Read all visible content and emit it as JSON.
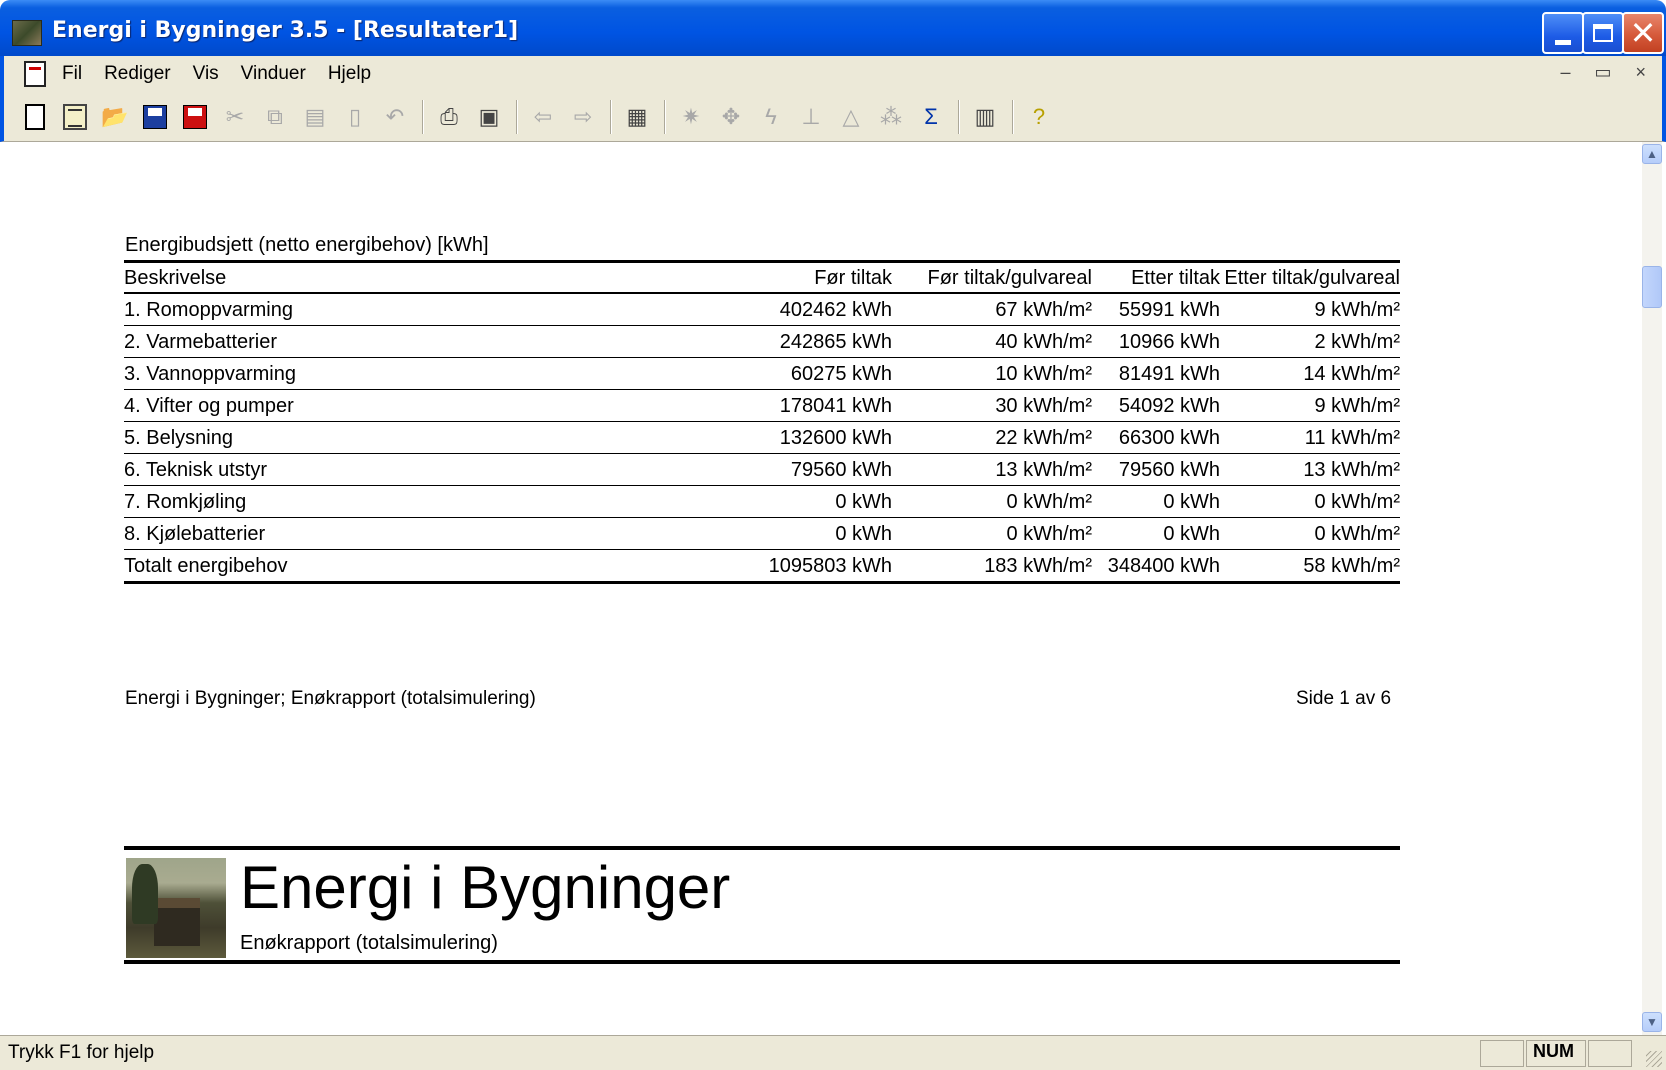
{
  "window": {
    "title": "Energi i Bygninger 3.5 - [Resultater1]"
  },
  "menu": {
    "items": [
      "Fil",
      "Rediger",
      "Vis",
      "Vinduer",
      "Hjelp"
    ]
  },
  "toolbar": {
    "icons": [
      "new-document-icon",
      "open-sheet-icon",
      "open-folder-icon",
      "save-icon",
      "save-as-icon",
      "cut-icon",
      "copy-icon",
      "paste-icon",
      "clipboard-icon",
      "undo-icon",
      "print-icon",
      "print-preview-icon",
      "back-arrow-icon",
      "forward-arrow-icon",
      "calculator-icon",
      "sun-icon",
      "crosshair-icon",
      "lightning-icon",
      "building-icon",
      "shape-icon",
      "sparkle-icon",
      "sigma-icon",
      "monitor-icon",
      "help-icon"
    ]
  },
  "report": {
    "section_title": "Energibudsjett (netto energibehov) [kWh]",
    "columns": [
      "Beskrivelse",
      "Før tiltak",
      "Før tiltak/gulvareal",
      "Etter tiltak",
      "Etter tiltak/gulvareal"
    ],
    "rows": [
      [
        "1. Romoppvarming",
        "402462 kWh",
        "67 kWh/m²",
        "55991 kWh",
        "9 kWh/m²"
      ],
      [
        "2. Varmebatterier",
        "242865 kWh",
        "40 kWh/m²",
        "10966 kWh",
        "2 kWh/m²"
      ],
      [
        "3. Vannoppvarming",
        "60275 kWh",
        "10 kWh/m²",
        "81491 kWh",
        "14 kWh/m²"
      ],
      [
        "4. Vifter og pumper",
        "178041 kWh",
        "30 kWh/m²",
        "54092 kWh",
        "9 kWh/m²"
      ],
      [
        "5. Belysning",
        "132600 kWh",
        "22 kWh/m²",
        "66300 kWh",
        "11 kWh/m²"
      ],
      [
        "6. Teknisk utstyr",
        "79560 kWh",
        "13 kWh/m²",
        "79560 kWh",
        "13 kWh/m²"
      ],
      [
        "7. Romkjøling",
        "0 kWh",
        "0 kWh/m²",
        "0 kWh",
        "0 kWh/m²"
      ],
      [
        "8. Kjølebatterier",
        "0 kWh",
        "0 kWh/m²",
        "0 kWh",
        "0 kWh/m²"
      ]
    ],
    "total": [
      "Totalt energibehov",
      "1095803 kWh",
      "183 kWh/m²",
      "348400 kWh",
      "58 kWh/m²"
    ],
    "footer_left": "Energi i Bygninger; Enøkrapport (totalsimulering)",
    "footer_right": "Side  1 av 6",
    "header_title": "Energi i Bygninger",
    "header_subtitle": "Enøkrapport (totalsimulering)"
  },
  "status": {
    "text": "Trykk F1 for hjelp",
    "num": "NUM"
  },
  "colors": {
    "titlebar": "#0054e3",
    "chrome": "#ece9d8",
    "close_button": "#d65a3b"
  }
}
